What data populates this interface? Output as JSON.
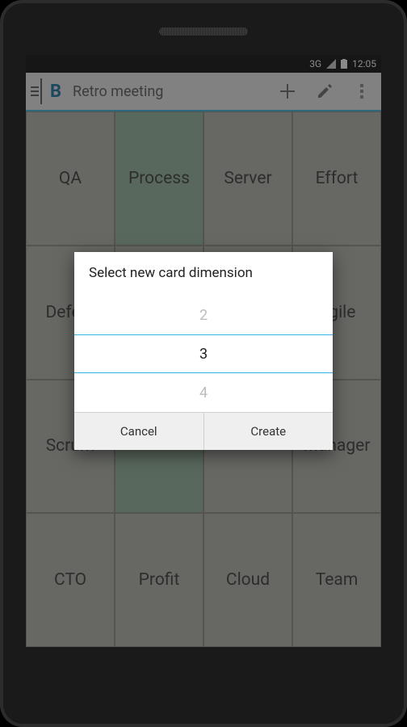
{
  "status_bar": {
    "network": "3G",
    "time": "12:05"
  },
  "action_bar": {
    "title": "Retro meeting"
  },
  "grid": {
    "cells": [
      {
        "label": "QA",
        "green": false
      },
      {
        "label": "Process",
        "green": true
      },
      {
        "label": "Server",
        "green": false
      },
      {
        "label": "Effort",
        "green": false
      },
      {
        "label": "Defect",
        "green": false
      },
      {
        "label": "",
        "green": false
      },
      {
        "label": "",
        "green": false
      },
      {
        "label": "Agile",
        "green": false
      },
      {
        "label": "Scrum",
        "green": false
      },
      {
        "label": "",
        "green": true
      },
      {
        "label": "",
        "green": false
      },
      {
        "label": "Manager",
        "green": false
      },
      {
        "label": "CTO",
        "green": false
      },
      {
        "label": "Profit",
        "green": false
      },
      {
        "label": "Cloud",
        "green": false
      },
      {
        "label": "Team",
        "green": false
      }
    ]
  },
  "dialog": {
    "title": "Select new card dimension",
    "options": {
      "prev": "2",
      "selected": "3",
      "next": "4"
    },
    "cancel_label": "Cancel",
    "create_label": "Create"
  }
}
